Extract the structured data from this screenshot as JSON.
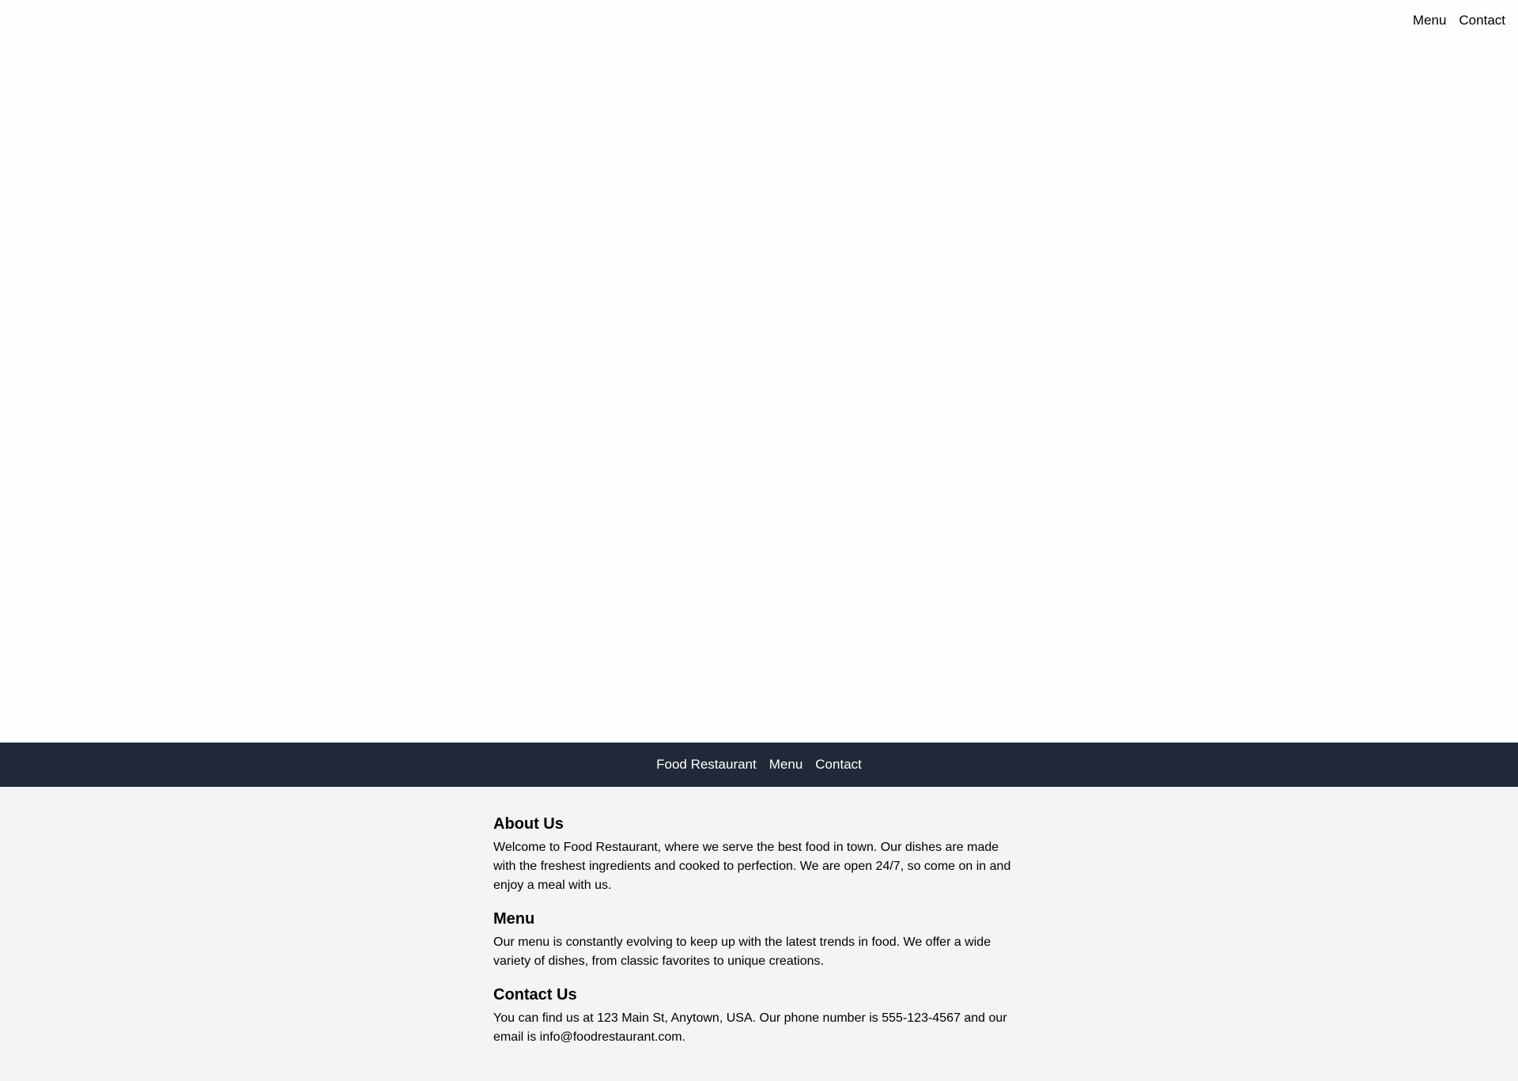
{
  "top_nav": {
    "menu": "Menu",
    "contact": "Contact"
  },
  "nav_bar": {
    "brand": "Food Restaurant",
    "menu": "Menu",
    "contact": "Contact"
  },
  "sections": [
    {
      "heading": "About Us",
      "body": "Welcome to Food Restaurant, where we serve the best food in town. Our dishes are made with the freshest ingredients and cooked to perfection. We are open 24/7, so come on in and enjoy a meal with us."
    },
    {
      "heading": "Menu",
      "body": "Our menu is constantly evolving to keep up with the latest trends in food. We offer a wide variety of dishes, from classic favorites to unique creations."
    },
    {
      "heading": "Contact Us",
      "body": "You can find us at 123 Main St, Anytown, USA. Our phone number is 555-123-4567 and our email is info@foodrestaurant.com."
    }
  ],
  "colors": {
    "nav_bg": "#1f2937",
    "content_bg": "#f3f4f6",
    "page_bg": "#ffffff"
  }
}
